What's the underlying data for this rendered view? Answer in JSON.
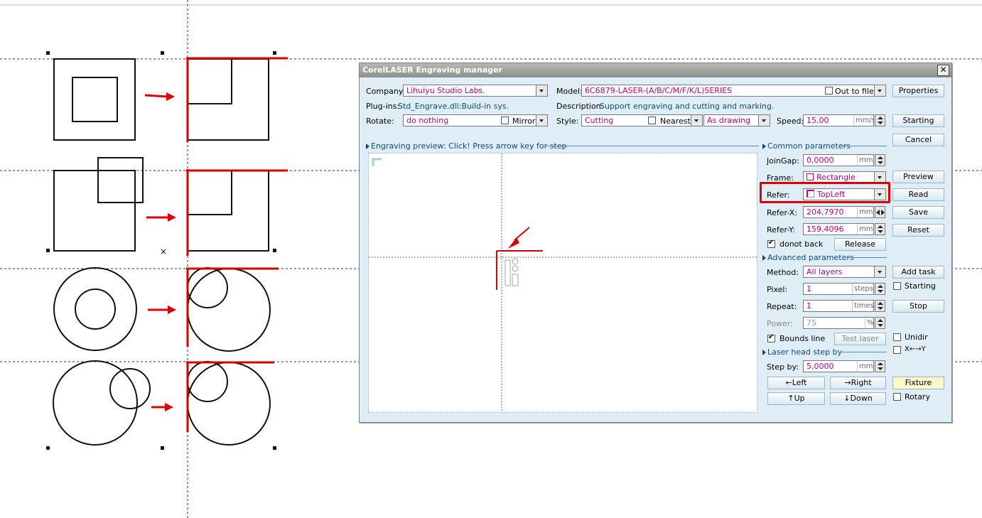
{
  "dialog": {
    "title": "CorelLASER Engraving manager",
    "close_glyph": "✕",
    "company_label": "Company:",
    "company_value": "Lihuiyu Studio Labs.",
    "model_label": "Model:",
    "model_value": "6C6879-LASER-(A/B/C/M/F/K/L)SERIES",
    "out_to_file_label": "Out to file",
    "properties_label": "Properties",
    "plugins_label": "Plug-ins:",
    "plugins_value": "Std_Engrave.dll:Build-in sys.",
    "description_label": "Description:",
    "description_value": "Support engraving and cutting and marking.",
    "rotate_label": "Rotate:",
    "rotate_value": "do nothing",
    "mirror_label": "Mirror",
    "style_label": "Style:",
    "style_value": "Cutting",
    "nearest_label": "Nearest",
    "order_value": "As drawing",
    "speed_label": "Speed:",
    "speed_value": "15,00",
    "speed_unit": "mm/s",
    "starting_label": "Starting",
    "cancel_label": "Cancel",
    "preview_section": "Engraving preview: Click! Press arrow key for step",
    "common_section": "Common parameters",
    "joingap_label": "JoinGap:",
    "joingap_value": "0,0000",
    "joingap_unit": "mm",
    "frame_label": "Frame:",
    "frame_value": "Rectangle",
    "refer_label": "Refer:",
    "refer_value": "TopLeft",
    "referx_label": "Refer-X:",
    "referx_value": "204,7970",
    "referx_unit": "mm",
    "refery_label": "Refer-Y:",
    "refery_value": "159,4096",
    "refery_unit": "mm",
    "donotback_label": "donot back",
    "release_label": "Release",
    "preview_btn": "Preview",
    "read_btn": "Read",
    "save_btn": "Save",
    "reset_btn": "Reset",
    "advanced_section": "Advanced parameters",
    "method_label": "Method:",
    "method_value": "All layers",
    "pixel_label": "Pixel:",
    "pixel_value": "1",
    "pixel_unit": "steps",
    "repeat_label": "Repeat:",
    "repeat_value": "1",
    "repeat_unit": "times",
    "power_label": "Power:",
    "power_value": "75",
    "power_unit": "%",
    "bounds_label": "Bounds line",
    "testlaser_label": "Test laser",
    "addtask_label": "Add task",
    "starting2_label": "Starting",
    "stop_label": "Stop",
    "unidir_label": "Unidir",
    "xy_label": "X←→Y",
    "step_section": "Laser head step by",
    "stepby_label": "Step by:",
    "stepby_value": "5,0000",
    "stepby_unit": "mm",
    "left_btn": "←Left",
    "right_btn": "→Right",
    "up_btn": "↑Up",
    "down_btn": "↓Down",
    "fixture_btn": "Fixture",
    "rotary_label": "Rotary"
  },
  "colors": {
    "highlight": "#d80000",
    "value_text": "#c0008a",
    "info_text": "#0b4a8a",
    "dialog_bg": "#dfeef6"
  },
  "icons": [
    "close-icon",
    "dropdown-arrow-icon",
    "spin-arrows-icon",
    "checkbox-icon",
    "rectangle-icon",
    "topleft-icon",
    "red-arrow-icon",
    "section-triangle-icon"
  ]
}
